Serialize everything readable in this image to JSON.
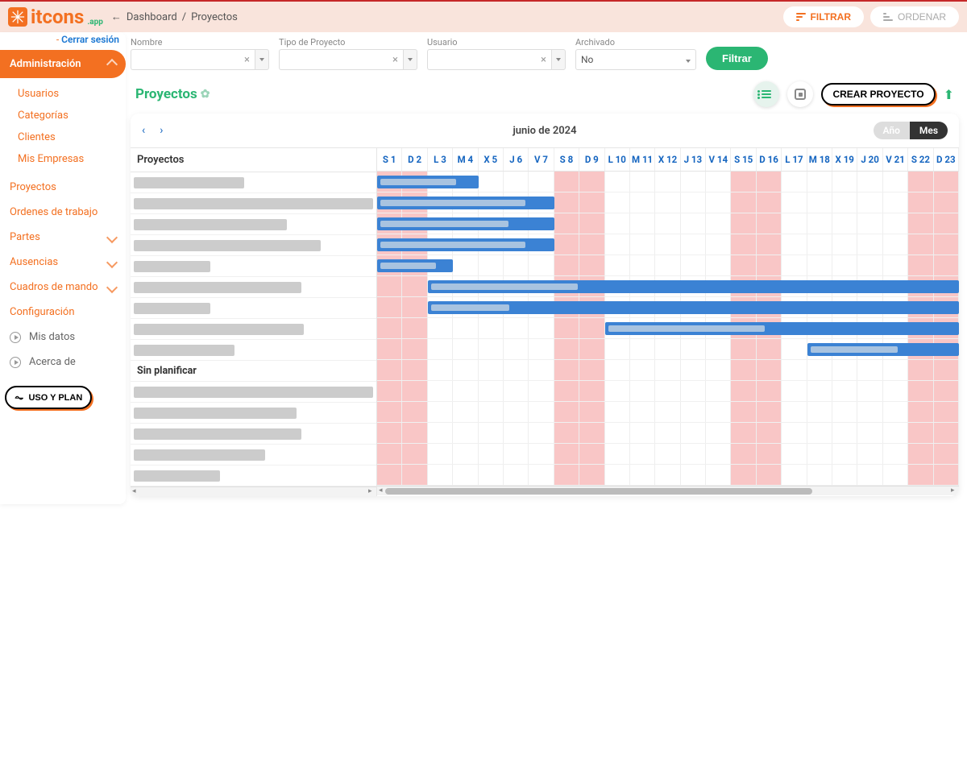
{
  "brand": {
    "name": "itcons",
    "suffix": ".app"
  },
  "session": {
    "logout_label": "Cerrar sesión",
    "divider": "- "
  },
  "breadcrumb": {
    "dashboard": "Dashboard",
    "sep": "/",
    "current": "Proyectos"
  },
  "header_buttons": {
    "filter": "FILTRAR",
    "sort": "ORDENAR"
  },
  "sidebar": {
    "admin": {
      "label": "Administración",
      "items": [
        "Usuarios",
        "Categorías",
        "Clientes",
        "Mis Empresas"
      ]
    },
    "items": [
      {
        "label": "Proyectos",
        "expandable": false
      },
      {
        "label": "Ordenes de trabajo",
        "expandable": false
      },
      {
        "label": "Partes",
        "expandable": true
      },
      {
        "label": "Ausencias",
        "expandable": true
      },
      {
        "label": "Cuadros de mando",
        "expandable": true
      },
      {
        "label": "Configuración",
        "expandable": false
      }
    ],
    "footer": [
      {
        "label": "Mis datos"
      },
      {
        "label": "Acerca de"
      }
    ],
    "uso_plan": "USO Y PLAN"
  },
  "filters": {
    "nombre": {
      "label": "Nombre",
      "value": ""
    },
    "tipo": {
      "label": "Tipo de Proyecto",
      "value": ""
    },
    "usuario": {
      "label": "Usuario",
      "value": ""
    },
    "archivado": {
      "label": "Archivado",
      "value": "No"
    },
    "submit": "Filtrar"
  },
  "page": {
    "title": "Proyectos",
    "create": "CREAR PROYECTO"
  },
  "gantt": {
    "title": "junio de 2024",
    "view_year": "Año",
    "view_month": "Mes",
    "left_header": "Proyectos",
    "unplanned_label": "Sin planificar",
    "days": [
      "S 1",
      "D 2",
      "L 3",
      "M 4",
      "X 5",
      "J 6",
      "V 7",
      "S 8",
      "D 9",
      "L 10",
      "M 11",
      "X 12",
      "J 13",
      "V 14",
      "S 15",
      "D 16",
      "L 17",
      "M 18",
      "X 19",
      "J 20",
      "V 21",
      "S 22",
      "D 23"
    ],
    "weekend_indices": [
      0,
      1,
      7,
      8,
      14,
      15,
      21,
      22
    ],
    "project_rows": [
      {
        "width_pct": 46
      },
      {
        "width_pct": 100
      },
      {
        "width_pct": 64
      },
      {
        "width_pct": 78
      },
      {
        "width_pct": 32
      },
      {
        "width_pct": 70
      },
      {
        "width_pct": 32
      },
      {
        "width_pct": 71
      },
      {
        "width_pct": 42
      }
    ],
    "unplanned_rows": [
      {
        "width_pct": 100
      },
      {
        "width_pct": 68
      },
      {
        "width_pct": 70
      },
      {
        "width_pct": 55
      },
      {
        "width_pct": 36
      }
    ],
    "bars": [
      {
        "row": 0,
        "start": 0,
        "span": 4,
        "inner_pct": 80
      },
      {
        "row": 1,
        "start": 0,
        "span": 7,
        "inner_pct": 85
      },
      {
        "row": 2,
        "start": 0,
        "span": 7,
        "inner_pct": 75
      },
      {
        "row": 3,
        "start": 0,
        "span": 7,
        "inner_pct": 85
      },
      {
        "row": 4,
        "start": 0,
        "span": 3,
        "inner_pct": 80
      },
      {
        "row": 5,
        "start": 2,
        "span": 21,
        "inner_pct": 28
      },
      {
        "row": 6,
        "start": 2,
        "span": 21,
        "inner_pct": 15
      },
      {
        "row": 7,
        "start": 9,
        "span": 14,
        "inner_pct": 45
      },
      {
        "row": 8,
        "start": 17,
        "span": 6,
        "inner_pct": 60
      }
    ]
  }
}
